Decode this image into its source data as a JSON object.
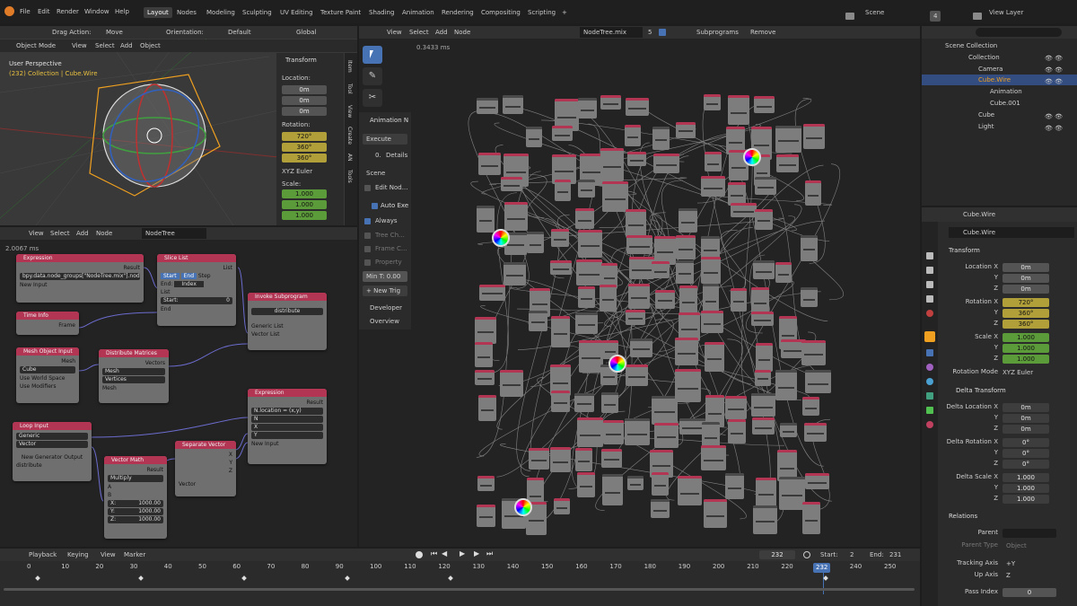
{
  "topbar": {
    "menus": [
      "File",
      "Edit",
      "Render",
      "Window",
      "Help"
    ],
    "tabs": [
      "Layout",
      "Nodes",
      "Modeling",
      "Sculpting",
      "UV Editing",
      "Texture Paint",
      "Shading",
      "Animation",
      "Rendering",
      "Compositing",
      "Scripting"
    ],
    "add_tab": "+",
    "scene": "Scene",
    "scene_num": "4",
    "view_layer": "View Layer"
  },
  "viewport": {
    "mode": "Object Mode",
    "menus": [
      "View",
      "Select",
      "Add",
      "Object"
    ],
    "drag_label": "Drag Action:",
    "drag_value": "Move",
    "orient_label": "Orientation:",
    "orient_value": "Default",
    "transform_space": "Global",
    "perspective": "User Perspective",
    "collection_info": "(232) Collection | Cube.Wire"
  },
  "npanel": {
    "title": "Transform",
    "location": "Location:",
    "loc": [
      "0m",
      "0m",
      "0m"
    ],
    "rotation": "Rotation:",
    "rot": [
      "720°",
      "360°",
      "360°"
    ],
    "euler": "XYZ Euler",
    "scale": "Scale:",
    "sc": [
      "1.000",
      "1.000",
      "1.000"
    ],
    "axes": [
      "X:",
      "Y:",
      "Z:"
    ],
    "side_tabs": [
      "Item",
      "Tool",
      "View",
      "Create",
      "AN",
      "Tools"
    ]
  },
  "node_editor_top": {
    "menus": [
      "View",
      "Select",
      "Add",
      "Node"
    ],
    "tree_name": "NodeTree.mix",
    "users": "5",
    "subprograms": "Subprograms",
    "remove": "Remove",
    "time": "0.3433 ms"
  },
  "an_panel": {
    "title": "Animation N",
    "execute": "Execute",
    "details_num": "0.",
    "details": "Details",
    "scene_lbl": "Scene",
    "edit_node": "Edit Nod...",
    "auto_exec": "Auto Exe",
    "always": "Always",
    "tree_changed": "Tree Ch...",
    "frame_changed": "Frame C...",
    "property": "Property",
    "min_time": "Min T: 0.00",
    "new_trigger": "+ New Trig",
    "developer": "Developer",
    "overview": "Overview"
  },
  "node_editor_bottom": {
    "menus": [
      "View",
      "Select",
      "Add",
      "Node"
    ],
    "tree_name": "NodeTree",
    "time": "2.0067 ms"
  },
  "nodes": {
    "expression1": {
      "title": "Expression",
      "result": "Result",
      "code": "bpy.data.node_groups[\"NodeTree.mix\"].nodes[...]",
      "new_input": "New Input"
    },
    "slice_list": {
      "title": "Slice List",
      "list": "List",
      "start": "Start",
      "end": "End",
      "step": "Step",
      "end_lbl": "End:",
      "index": "Index",
      "list_in": "List",
      "start_in": "Start:",
      "start_val": "0",
      "end_in": "End"
    },
    "invoke": {
      "title": "Invoke Subprogram",
      "sub": "distribute",
      "generic_list": "Generic List",
      "vector_list": "Vector List"
    },
    "time_info": {
      "title": "Time Info",
      "frame": "Frame"
    },
    "mesh_object": {
      "title": "Mesh Object Input",
      "mesh": "Mesh",
      "object": "Cube",
      "world": "Use World Space",
      "modifiers": "Use Modifiers"
    },
    "distribute": {
      "title": "Distribute Matrices",
      "vectors": "Vectors",
      "mode": "Mesh",
      "type": "Vertices",
      "mesh": "Mesh"
    },
    "expression2": {
      "title": "Expression",
      "result": "Result",
      "code": "N.location = (x,y)",
      "n": "N",
      "x": "X",
      "y": "Y",
      "new_input": "New Input"
    },
    "loop_input": {
      "title": "Loop Input",
      "generic": "Generic",
      "vector": "Vector",
      "new_gen": "New Generator Output",
      "dist": "distribute"
    },
    "vector_math": {
      "title": "Vector Math",
      "result": "Result",
      "op": "Multiply",
      "a": "A",
      "b": "B",
      "bx": "X:",
      "bxv": "1000.00",
      "by": "Y:",
      "byv": "1000.00",
      "bz": "Z:",
      "bzv": "1000.00"
    },
    "separate": {
      "title": "Separate Vector",
      "x": "X",
      "y": "Y",
      "z": "Z",
      "vector": "Vector"
    }
  },
  "timeline": {
    "menus": [
      "Playback",
      "Keying",
      "View",
      "Marker"
    ],
    "current": "232",
    "start_lbl": "Start:",
    "start": "2",
    "end_lbl": "End:",
    "end": "231",
    "ticks": [
      "0",
      "10",
      "20",
      "30",
      "40",
      "50",
      "60",
      "70",
      "80",
      "90",
      "100",
      "110",
      "120",
      "130",
      "140",
      "150",
      "160",
      "170",
      "180",
      "190",
      "200",
      "210",
      "220",
      "230",
      "240",
      "250"
    ],
    "playhead": "232"
  },
  "outliner": {
    "root": "Scene Collection",
    "items": [
      {
        "name": "Collection",
        "level": 1
      },
      {
        "name": "Camera",
        "level": 2
      },
      {
        "name": "Cube.Wire",
        "level": 2
      },
      {
        "name": "Animation",
        "level": 3
      },
      {
        "name": "Cube.001",
        "level": 3
      },
      {
        "name": "Cube",
        "level": 2
      },
      {
        "name": "Light",
        "level": 2
      }
    ]
  },
  "properties": {
    "object": "Cube.Wire",
    "object_field": "Cube.Wire",
    "transform": "Transform",
    "loc_x": "Location X",
    "y": "Y",
    "z": "Z",
    "loc": [
      "0m",
      "0m",
      "0m"
    ],
    "rot_x": "Rotation X",
    "rot": [
      "720°",
      "360°",
      "360°"
    ],
    "scale_x": "Scale X",
    "sc": [
      "1.000",
      "1.000",
      "1.000"
    ],
    "rot_mode": "Rotation Mode",
    "rot_mode_val": "XYZ Euler",
    "delta": "Delta Transform",
    "dloc_x": "Delta Location X",
    "dloc": [
      "0m",
      "0m",
      "0m"
    ],
    "drot_x": "Delta Rotation X",
    "drot": [
      "0°",
      "0°",
      "0°"
    ],
    "dsc_x": "Delta Scale X",
    "dsc": [
      "1.000",
      "1.000",
      "1.000"
    ],
    "relations": "Relations",
    "parent": "Parent",
    "parent_type": "Parent Type",
    "parent_type_val": "Object",
    "track": "Tracking Axis",
    "track_val": "+Y",
    "up": "Up Axis",
    "up_val": "Z",
    "pass_index": "Pass Index",
    "pass_val": "0"
  },
  "colors": {
    "accent": "#4772b3",
    "node_header": "#b23554",
    "yellow": "#b1a03a",
    "green": "#5c9b3a",
    "selected": "#f0a020"
  }
}
